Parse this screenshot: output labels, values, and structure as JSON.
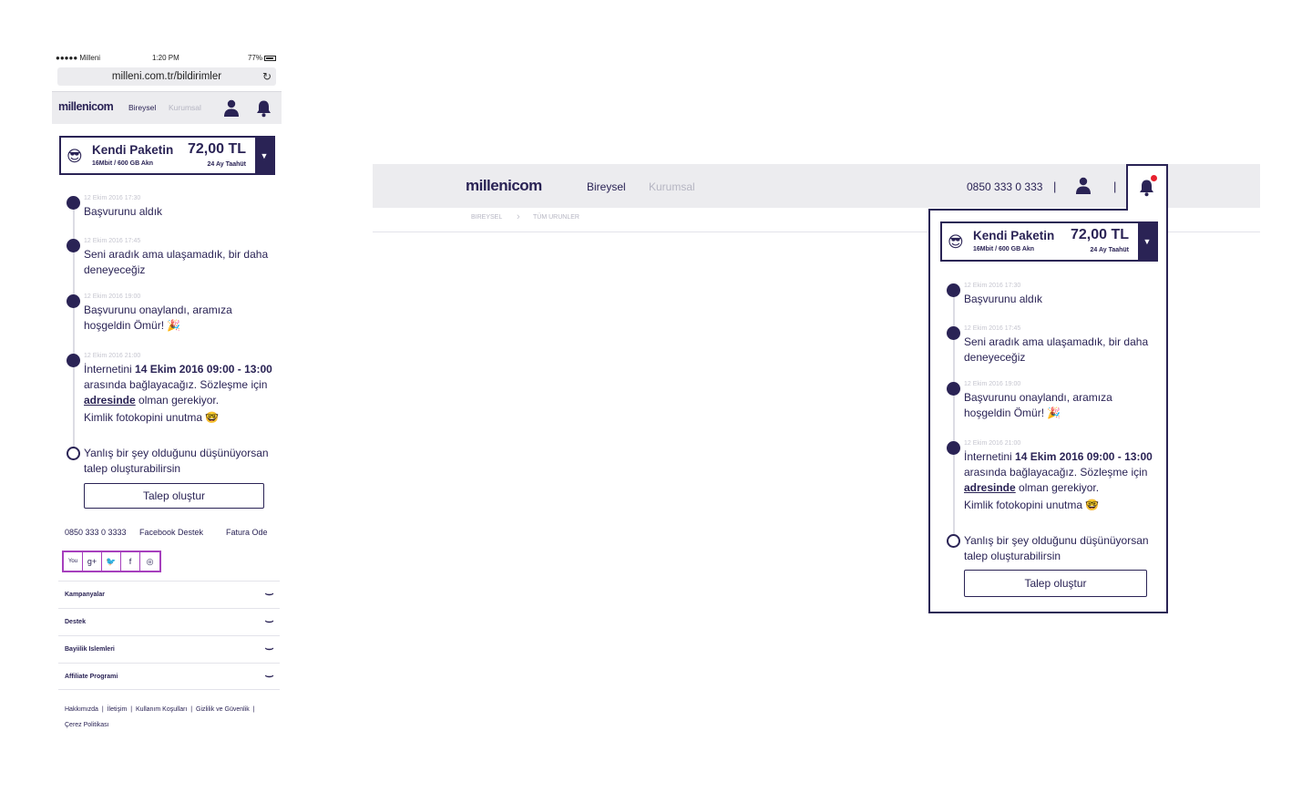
{
  "mobile": {
    "statusbar": {
      "carrier": "●●●●● Milleni",
      "time": "1:20 PM",
      "battery": "77%"
    },
    "url": "milleni.com.tr/bildirimler",
    "header": {
      "logo": "millenicom",
      "nav_personal": "Bireysel",
      "nav_corporate": "Kurumsal"
    },
    "package": {
      "name": "Kendi Paketin",
      "subtitle": "16Mbit / 600 GB Akn",
      "price": "72,00 TL",
      "term": "24 Ay Taahüt",
      "emoji": "😎"
    },
    "timeline": [
      {
        "time": "12 Ekim 2016 17:30",
        "text": "Başvurunu aldık"
      },
      {
        "time": "12 Ekim 2016 17:45",
        "text": "Seni aradık ama ulaşamadık, bir daha deneyeceğiz"
      },
      {
        "time": "12 Ekim 2016 19:00",
        "text_a": "Başvurunu onaylandı, aramıza",
        "text_b": "hoşgeldin Ömür! 🎉"
      },
      {
        "time": "12 Ekim 2016 21:00",
        "pre": "İnternetini",
        "date": "14 Ekim 2016 09:00 - 13:00",
        "mid": "arasında bağlayacağız. Sözleşme için",
        "link": "adresinde",
        "post": "olman gerekiyor.",
        "last": "Kimlik fotokopini unutma 🤓"
      }
    ],
    "problem": {
      "text": "Yanlış bir şey olduğunu düşünüyorsan talep oluşturabilirsin",
      "button": "Talep oluştur"
    },
    "contacts": {
      "phone": "0850 333 0 3333",
      "facebook": "Facebook Destek",
      "invoice": "Fatura Ode"
    },
    "social": [
      "You",
      "g+",
      "🐦",
      "f",
      "◎"
    ],
    "accordion": [
      "Kampanyalar",
      "Destek",
      "Bayiilik Islemleri",
      "Affiliate Programi"
    ],
    "footer_links": [
      "Hakkımızda",
      "İletişim",
      "Kullanım Koşulları",
      "Gizlilik ve Güvenlik",
      "Çerez Politikası"
    ]
  },
  "desktop": {
    "header": {
      "logo": "millenicom",
      "nav_personal": "Bireysel",
      "nav_corporate": "Kurumsal",
      "phone": "0850 333 0 333",
      "sep": "|"
    },
    "breadcrumb": [
      "BIREYSEL",
      "TÜM URUNLER"
    ],
    "package": {
      "name": "Kendi Paketin",
      "subtitle": "16Mbit / 600 GB Akn",
      "price": "72,00 TL",
      "term": "24 Ay Taahüt",
      "emoji": "😎"
    },
    "timeline": [
      {
        "time": "12 Ekim 2016 17:30",
        "text": "Başvurunu aldık"
      },
      {
        "time": "12 Ekim 2016 17:45",
        "text": "Seni aradık ama ulaşamadık, bir daha deneyeceğiz"
      },
      {
        "time": "12 Ekim 2016 19:00",
        "text_a": "Başvurunu onaylandı, aramıza",
        "text_b": "hoşgeldin Ömür! 🎉"
      },
      {
        "time": "12 Ekim 2016 21:00",
        "pre": "İnternetini",
        "date": "14 Ekim 2016 09:00 - 13:00",
        "mid": "arasında bağlayacağız. Sözleşme için",
        "link": "adresinde",
        "post": "olman gerekiyor.",
        "last": "Kimlik fotokopini unutma 🤓"
      }
    ],
    "problem": {
      "text": "Yanlış bir şey olduğunu düşünüyorsan talep oluşturabilirsin",
      "button": "Talep oluştur"
    }
  },
  "colors": {
    "brand": "#2a2355",
    "header_bg": "#ececef",
    "badge": "#e8202e",
    "social_border": "#a63fbd"
  },
  "icons": [
    "user-icon",
    "bell-icon",
    "reload-icon",
    "chevron-down-icon",
    "youtube-icon",
    "google-plus-icon",
    "twitter-icon",
    "facebook-icon",
    "instagram-icon"
  ]
}
